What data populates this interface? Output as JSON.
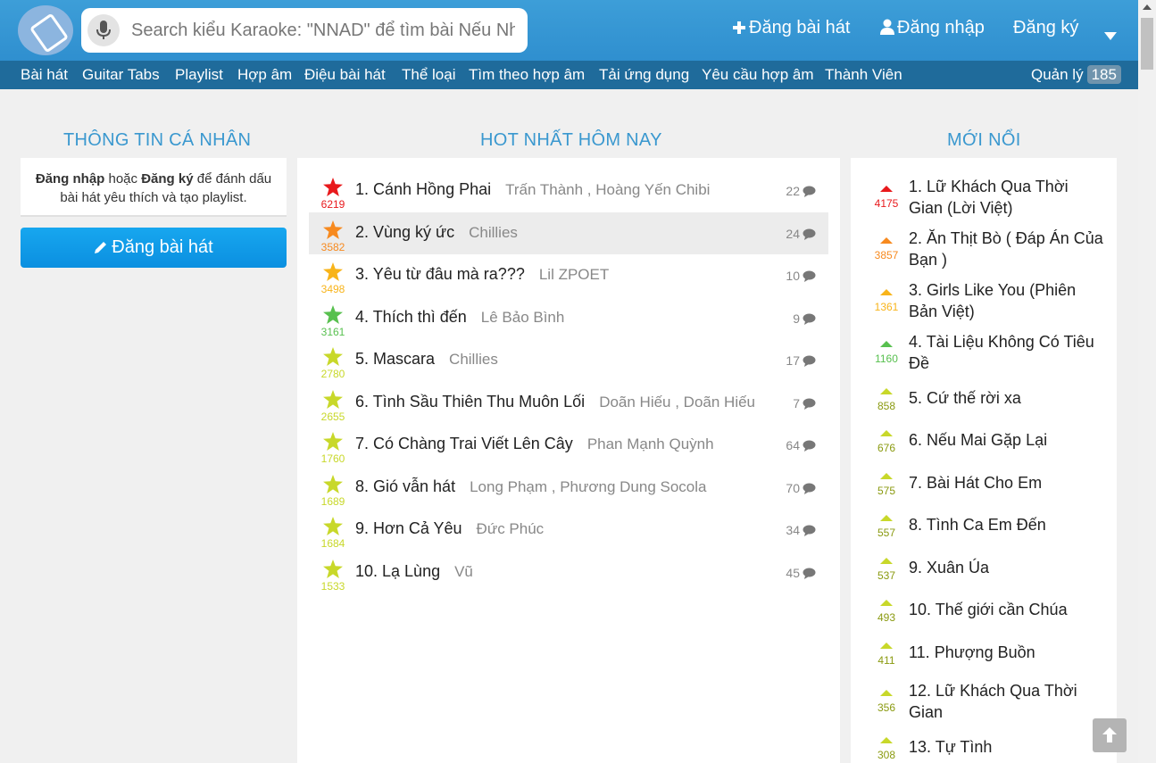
{
  "search": {
    "placeholder": "Search kiểu Karaoke: \"NNAD\" để tìm bài Nếu Như Anh Đến"
  },
  "header": {
    "post_song": "Đăng bài hát",
    "login": "Đăng nhập",
    "register": "Đăng ký"
  },
  "nav": {
    "items": [
      "Bài hát",
      "Guitar Tabs",
      "Playlist",
      "Hợp âm",
      "Điệu bài hát",
      "Thể loại",
      "Tìm theo hợp âm",
      "Tải ứng dụng",
      "Yêu cầu hợp âm",
      "Thành Viên"
    ],
    "manage_label": "Quản lý",
    "manage_count": "185"
  },
  "personal": {
    "title": "THÔNG TIN CÁ NHÂN",
    "login_word": "Đăng nhập",
    "or_word": " hoặc ",
    "register_word": "Đăng ký",
    "text_line1_rest": " để đánh dấu",
    "text_line2": "bài hát yêu thích và tạo playlist.",
    "post_button": "Đăng bài hát"
  },
  "hot": {
    "title": "HOT NHẤT HÔM NAY",
    "items": [
      {
        "title": "1. Cánh Hồng Phai",
        "artist": "Trấn Thành , Hoàng Yến Chibi",
        "score": "6219",
        "comments": "22",
        "color": "#e8191c"
      },
      {
        "title": "2. Vùng ký ức",
        "artist": "Chillies",
        "score": "3582",
        "comments": "24",
        "color": "#f78a1f"
      },
      {
        "title": "3. Yêu từ đâu mà ra???",
        "artist": "Lil ZPOET",
        "score": "3498",
        "comments": "10",
        "color": "#f8b41a"
      },
      {
        "title": "4. Thích thì đến",
        "artist": "Lê Bảo Bình",
        "score": "3161",
        "comments": "9",
        "color": "#58c04f"
      },
      {
        "title": "5. Mascara",
        "artist": "Chillies",
        "score": "2780",
        "comments": "17",
        "color": "#c8d82a"
      },
      {
        "title": "6. Tình Sầu Thiên Thu Muôn Lối",
        "artist": "Doãn Hiếu , Doãn Hiếu",
        "score": "2655",
        "comments": "7",
        "color": "#c8d82a"
      },
      {
        "title": "7. Có Chàng Trai Viết Lên Cây",
        "artist": "Phan Mạnh Quỳnh",
        "score": "1760",
        "comments": "64",
        "color": "#c8d82a"
      },
      {
        "title": "8. Gió vẫn hát",
        "artist": "Long Phạm , Phương Dung Socola",
        "score": "1689",
        "comments": "70",
        "color": "#c8d82a"
      },
      {
        "title": "9. Hơn Cả Yêu",
        "artist": "Đức Phúc",
        "score": "1684",
        "comments": "34",
        "color": "#c8d82a"
      },
      {
        "title": "10. Lạ Lùng",
        "artist": "Vũ",
        "score": "1533",
        "comments": "45",
        "color": "#c8d82a"
      }
    ]
  },
  "new": {
    "title": "MỚI NỔI",
    "items": [
      {
        "title": "1. Lữ Khách Qua Thời Gian (Lời Việt)",
        "score": "4175",
        "color": "#e8191c"
      },
      {
        "title": "2. Ăn Thịt Bò ( Đáp Án Của Bạn )",
        "score": "3857",
        "color": "#f78a1f"
      },
      {
        "title": "3. Girls Like You (Phiên Bản Việt)",
        "score": "1361",
        "color": "#f8b41a"
      },
      {
        "title": "4. Tài Liệu Không Có Tiêu Đề",
        "score": "1160",
        "color": "#58c04f"
      },
      {
        "title": "5. Cứ thế rời xa",
        "score": "858",
        "color": "#c8d82a"
      },
      {
        "title": "6. Nếu Mai Gặp Lại",
        "score": "676",
        "color": "#c8d82a"
      },
      {
        "title": "7. Bài Hát Cho Em",
        "score": "575",
        "color": "#c8d82a"
      },
      {
        "title": "8. Tình Ca Em Đến",
        "score": "557",
        "color": "#c8d82a"
      },
      {
        "title": "9. Xuân Úa",
        "score": "537",
        "color": "#c8d82a"
      },
      {
        "title": "10. Thế giới cần Chúa",
        "score": "493",
        "color": "#c8d82a"
      },
      {
        "title": "11. Phượng Buồn",
        "score": "411",
        "color": "#c8d82a"
      },
      {
        "title": "12. Lữ Khách Qua Thời Gian",
        "score": "356",
        "color": "#c8d82a"
      },
      {
        "title": "13. Tự Tình",
        "score": "308",
        "color": "#c8d82a"
      }
    ]
  },
  "icons": {
    "logo": "guitar-logo-icon",
    "mic": "microphone-icon",
    "plus": "plus-icon",
    "user": "user-icon",
    "caret": "caret-down-icon",
    "pencil": "pencil-icon",
    "star": "star-icon",
    "comment": "comment-icon",
    "trend": "trend-up-icon",
    "arrow_up": "arrow-up-icon"
  }
}
